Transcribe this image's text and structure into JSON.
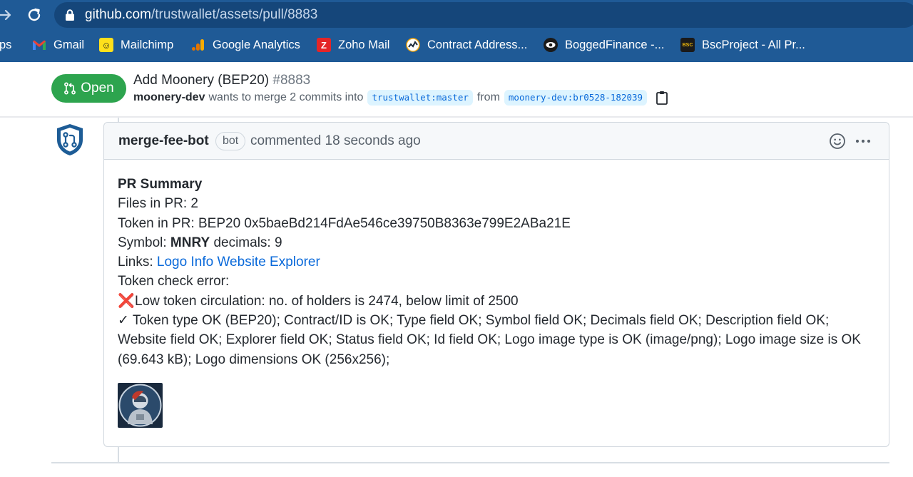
{
  "browser": {
    "url_host": "github.com",
    "url_path": "/trustwallet/assets/pull/8883",
    "bookmarks": [
      {
        "label": "ps",
        "icon": "apps-icon",
        "color": "#1f5a96"
      },
      {
        "label": "Gmail",
        "icon": "gmail-icon",
        "color": "#ea4335"
      },
      {
        "label": "Mailchimp",
        "icon": "mailchimp-icon",
        "color": "#ffe01b"
      },
      {
        "label": "Google Analytics",
        "icon": "google-analytics-icon",
        "color": "#f9ab00"
      },
      {
        "label": "Zoho Mail",
        "icon": "zoho-mail-icon",
        "color": "#e42527"
      },
      {
        "label": "Contract Address...",
        "icon": "contract-address-icon",
        "color": "#ffffff"
      },
      {
        "label": "BoggedFinance -...",
        "icon": "eye-icon",
        "color": "#1a1a1a"
      },
      {
        "label": "BscProject - All Pr...",
        "icon": "bscproject-icon",
        "color": "#1a1a1a"
      }
    ]
  },
  "pr": {
    "state": "Open",
    "title": "Add Moonery (BEP20)",
    "number": "#8883",
    "author": "moonery-dev",
    "merge_text": "wants to merge 2 commits into",
    "base_branch": "trustwallet:master",
    "from_text": "from",
    "head_branch": "moonery-dev:br0528-182039"
  },
  "comment": {
    "author": "merge-fee-bot",
    "badge": "bot",
    "timestamp": "commented 18 seconds ago",
    "summary_title": "PR Summary",
    "files_line": "Files in PR: 2",
    "token_line": "Token in PR: BEP20 0x5baeBd214FdAe546ce39750B8363e799E2ABa21E",
    "symbol_label": "Symbol:",
    "symbol_value": "MNRY",
    "decimals_text": "decimals: 9",
    "links_label": "Links:",
    "links": [
      "Logo",
      "Info",
      "Website",
      "Explorer"
    ],
    "error_label": "Token check error:",
    "error_mark": "❌",
    "error_text": "Low token circulation: no. of holders is 2474, below limit of 2500",
    "ok_mark": "✓",
    "ok_text": "Token type OK (BEP20); Contract/ID is OK; Type field OK; Symbol field OK; Decimals field OK; Description field OK; Website field OK; Explorer field OK; Status field OK; Id field OK; Logo image type is OK (image/png); Logo image size is OK (69.643 kB); Logo dimensions OK (256x256);"
  },
  "colors": {
    "chrome": "#1f5a96",
    "open_green": "#2da44e",
    "link_blue": "#0969da",
    "error_red": "#d1242f"
  }
}
